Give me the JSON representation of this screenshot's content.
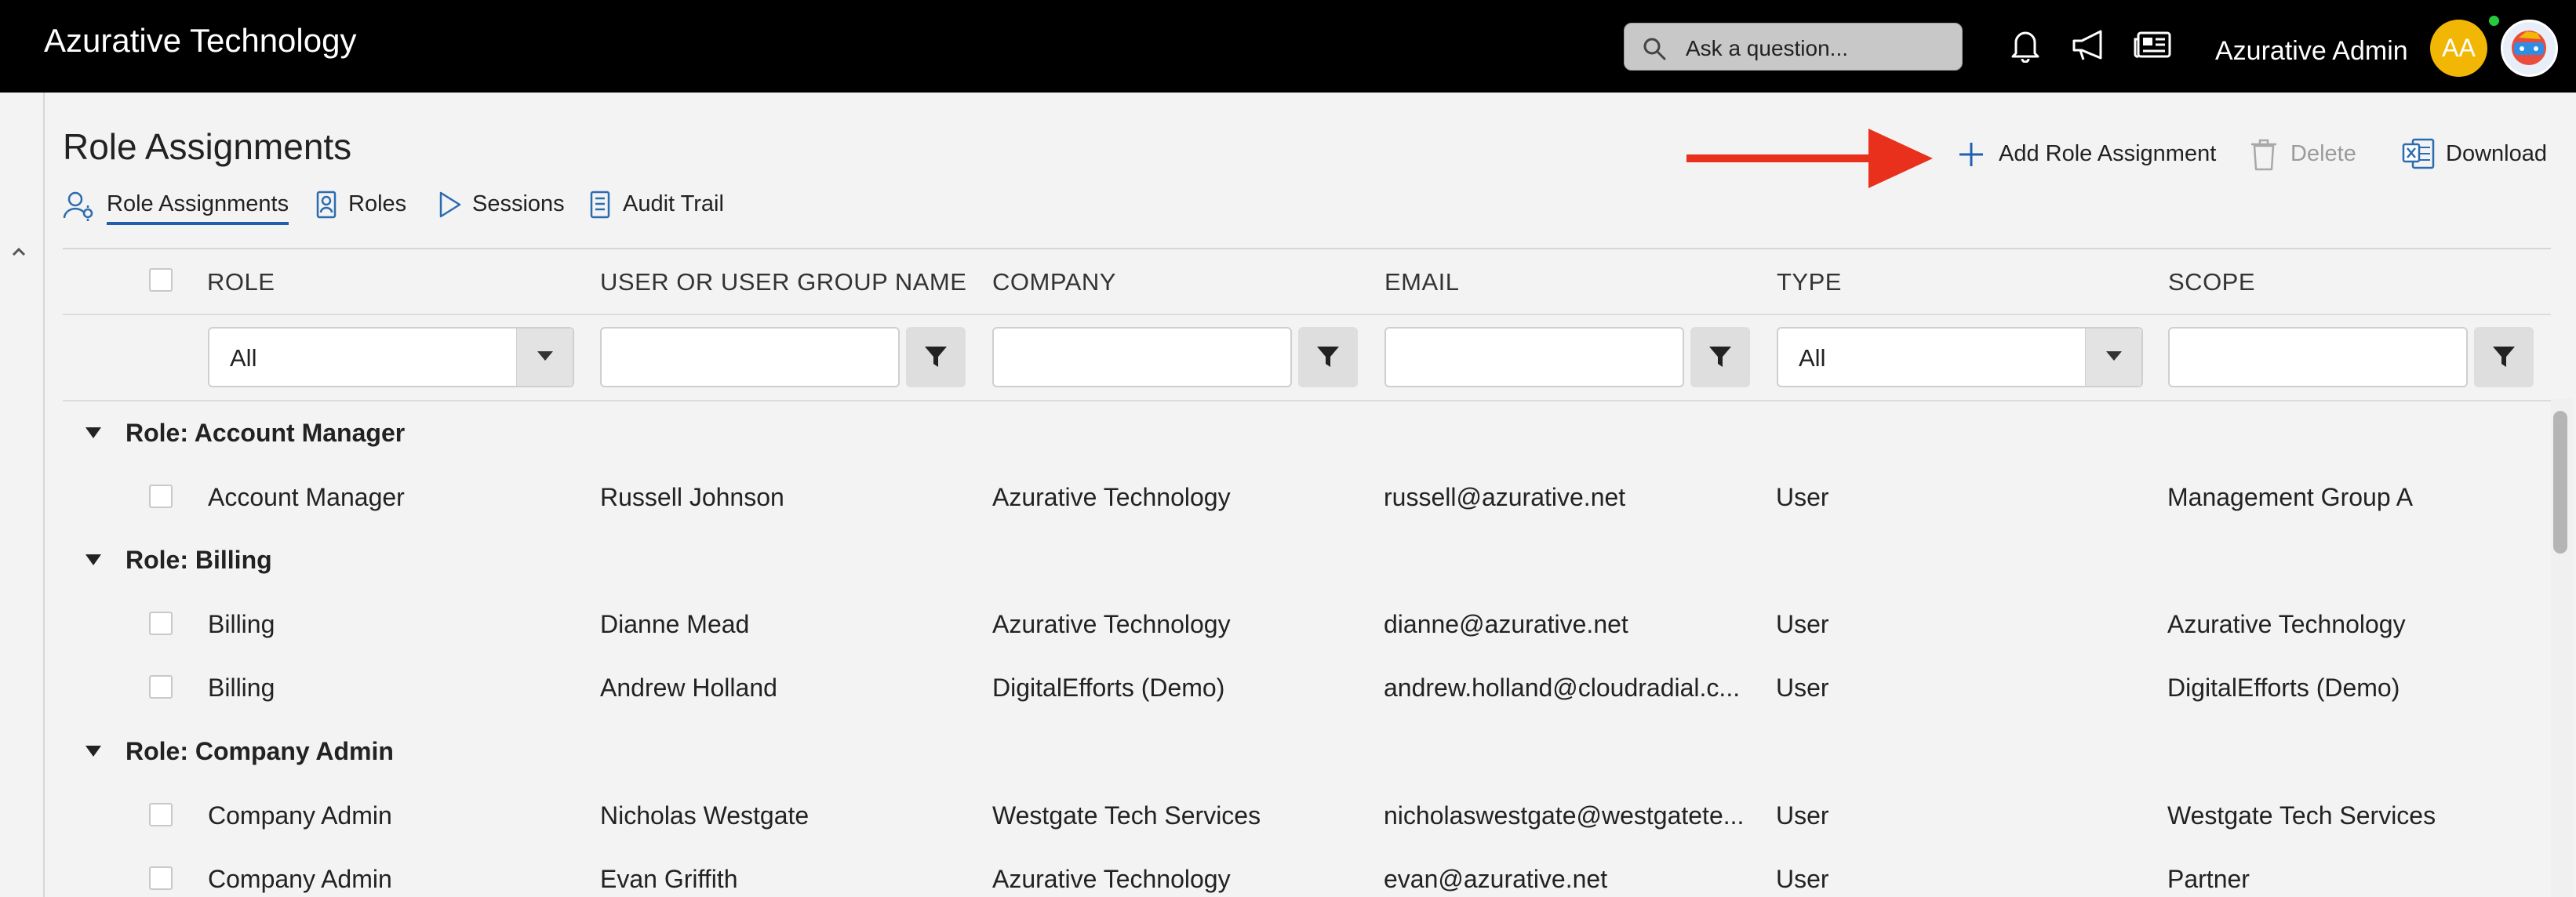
{
  "app": {
    "brand": "Azurative Technology",
    "admin_name": "Azurative Admin",
    "avatar_initials": "AA"
  },
  "search": {
    "placeholder": "Ask a question..."
  },
  "page": {
    "title": "Role Assignments"
  },
  "tabs": [
    {
      "label": "Role Assignments",
      "icon": "user-gear-icon",
      "active": true
    },
    {
      "label": "Roles",
      "icon": "badge-icon",
      "active": false
    },
    {
      "label": "Sessions",
      "icon": "play-icon",
      "active": false
    },
    {
      "label": "Audit Trail",
      "icon": "book-icon",
      "active": false
    }
  ],
  "actions": {
    "add": "Add Role Assignment",
    "delete": "Delete",
    "download": "Download"
  },
  "table": {
    "columns": [
      "ROLE",
      "USER OR USER GROUP NAME",
      "COMPANY",
      "EMAIL",
      "TYPE",
      "SCOPE"
    ],
    "filters": {
      "role": "All",
      "type": "All"
    },
    "groups": [
      {
        "label": "Role: Account Manager",
        "rows": [
          [
            "Account Manager",
            "Russell Johnson",
            "Azurative Technology",
            "russell@azurative.net",
            "User",
            "Management Group A"
          ]
        ]
      },
      {
        "label": "Role: Billing",
        "rows": [
          [
            "Billing",
            "Dianne Mead",
            "Azurative Technology",
            "dianne@azurative.net",
            "User",
            "Azurative Technology"
          ],
          [
            "Billing",
            "Andrew Holland",
            "DigitalEfforts (Demo)",
            "andrew.holland@cloudradial.c...",
            "User",
            "DigitalEfforts (Demo)"
          ]
        ]
      },
      {
        "label": "Role: Company Admin",
        "rows": [
          [
            "Company Admin",
            "Nicholas Westgate",
            "Westgate Tech Services",
            "nicholaswestgate@westgatete...",
            "User",
            "Westgate Tech Services"
          ],
          [
            "Company Admin",
            "Evan Griffith",
            "Azurative Technology",
            "evan@azurative.net",
            "User",
            "Partner"
          ]
        ]
      }
    ]
  },
  "colors": {
    "topbar": "#000000",
    "accent": "#1f5fae",
    "arrow": "#e8301c",
    "avatar": "#f2b705"
  }
}
